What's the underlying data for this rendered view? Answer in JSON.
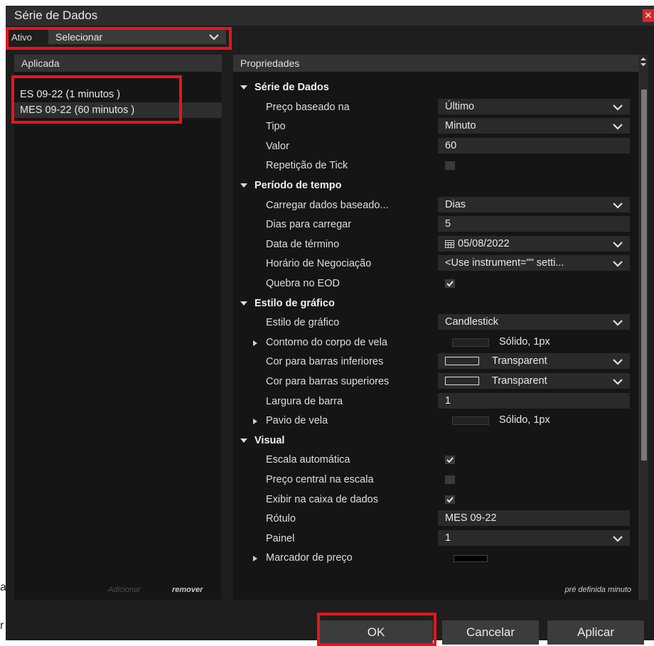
{
  "window": {
    "title": "Série de Dados",
    "close_glyph": "✕"
  },
  "ativo": {
    "label": "Ativo",
    "value": "Selecionar"
  },
  "left_panel": {
    "header": "Aplicada",
    "series": [
      "ES 09-22 (1 minutos )",
      "MES 09-22 (60 minutos )"
    ],
    "add_label": "Adicionar",
    "remove_label": "remover"
  },
  "right_panel": {
    "header": "Propriedades",
    "footer": "pré definida minuto",
    "rows": [
      {
        "kind": "cat",
        "name": "Série de Dados"
      },
      {
        "kind": "prop",
        "name": "Preço baseado na",
        "value": "Último",
        "control": "dropdown"
      },
      {
        "kind": "prop",
        "name": "Tipo",
        "value": "Minuto",
        "control": "dropdown"
      },
      {
        "kind": "prop",
        "name": "Valor",
        "value": "60",
        "control": "text"
      },
      {
        "kind": "prop",
        "name": "Repetição de Tick",
        "control": "checkbox",
        "checked": false
      },
      {
        "kind": "cat",
        "name": "Período de tempo"
      },
      {
        "kind": "prop",
        "name": "Carregar dados baseado...",
        "value": "Dias",
        "control": "dropdown"
      },
      {
        "kind": "prop",
        "name": "Dias para carregar",
        "value": "5",
        "control": "text"
      },
      {
        "kind": "prop",
        "name": "Data de término",
        "value": "05/08/2022",
        "control": "date"
      },
      {
        "kind": "prop",
        "name": "Horário de Negociação",
        "value": "<Use instrument=\"\" setti...",
        "control": "dropdown"
      },
      {
        "kind": "prop",
        "name": "Quebra no EOD",
        "control": "checkbox",
        "checked": true
      },
      {
        "kind": "cat",
        "name": "Estilo de gráfico"
      },
      {
        "kind": "prop",
        "name": "Estilo de gráfico",
        "value": "Candlestick",
        "control": "dropdown"
      },
      {
        "kind": "prop",
        "name": "Contorno do corpo de vela",
        "value": "Sólido, 1px",
        "control": "stroke",
        "expandable": true
      },
      {
        "kind": "prop",
        "name": "Cor para barras inferiores",
        "value": "Transparent",
        "control": "color",
        "expandable": false
      },
      {
        "kind": "prop",
        "name": "Cor para barras superiores",
        "value": "Transparent",
        "control": "color"
      },
      {
        "kind": "prop",
        "name": "Largura de barra",
        "value": "1",
        "control": "text"
      },
      {
        "kind": "prop",
        "name": "Pavio de vela",
        "value": "Sólido, 1px",
        "control": "stroke",
        "expandable": true
      },
      {
        "kind": "cat",
        "name": "Visual"
      },
      {
        "kind": "prop",
        "name": "Escala automática",
        "control": "checkbox",
        "checked": true
      },
      {
        "kind": "prop",
        "name": "Preço central na escala",
        "control": "checkbox",
        "checked": false
      },
      {
        "kind": "prop",
        "name": "Exibir na caixa de dados",
        "control": "checkbox",
        "checked": true
      },
      {
        "kind": "prop",
        "name": "Rótulo",
        "value": "MES 09-22",
        "control": "text"
      },
      {
        "kind": "prop",
        "name": "Painel",
        "value": "1",
        "control": "dropdown"
      },
      {
        "kind": "prop",
        "name": "Marcador de preço",
        "control": "colorbar",
        "expandable": true
      }
    ]
  },
  "buttons": {
    "ok": "OK",
    "cancel": "Cancelar",
    "apply": "Aplicar"
  },
  "background_text": [
    "a",
    "r"
  ],
  "colors": {
    "highlight": "#e8141c",
    "dialog_bg": "#1e1e1e",
    "panel_bg": "#151515",
    "close": "#d9262c"
  },
  "icons": {
    "dropdown": "chevron-down-icon",
    "date": "calendar-icon",
    "check": "checkmark-icon",
    "close": "close-icon"
  }
}
